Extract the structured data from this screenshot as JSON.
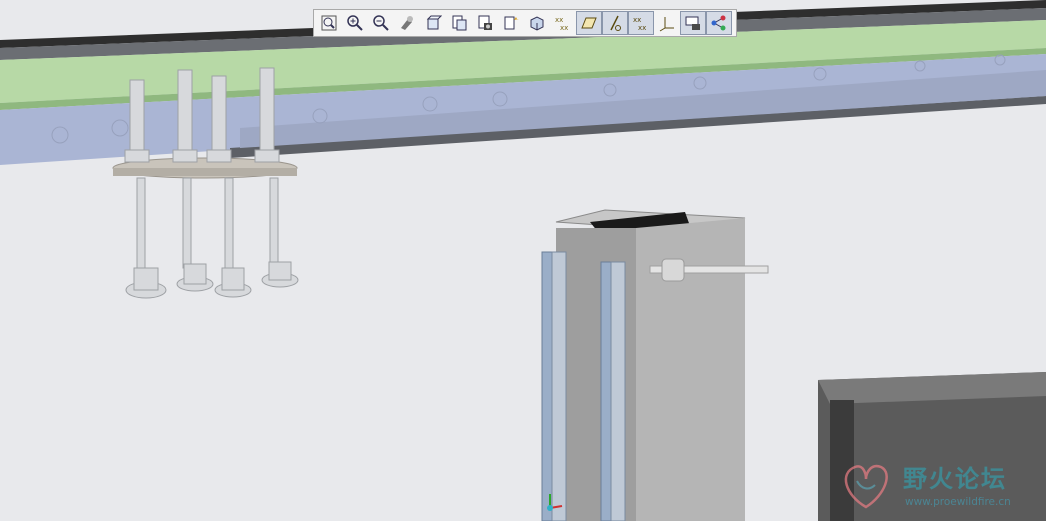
{
  "app": {
    "view_toolbar": {
      "buttons": [
        {
          "icon": "refit-icon",
          "toggled": false
        },
        {
          "icon": "zoom-in-icon",
          "toggled": false
        },
        {
          "icon": "zoom-out-icon",
          "toggled": false
        },
        {
          "icon": "repaint-icon",
          "toggled": false
        },
        {
          "icon": "display-style-icon",
          "toggled": false
        },
        {
          "icon": "saved-orientations-icon",
          "toggled": false
        },
        {
          "icon": "view-manager-icon",
          "toggled": false
        },
        {
          "icon": "spin-center-icon",
          "toggled": false
        },
        {
          "icon": "perspective-view-icon",
          "toggled": false
        },
        {
          "icon": "annotation-display-icon",
          "toggled": false
        },
        {
          "icon": "plane-display-icon",
          "toggled": true
        },
        {
          "icon": "axis-display-icon",
          "toggled": true
        },
        {
          "icon": "point-display-icon",
          "toggled": true
        },
        {
          "icon": "csys-display-icon",
          "toggled": false
        },
        {
          "icon": "appearance-editor-icon",
          "toggled": true
        },
        {
          "icon": "model-tree-icon",
          "toggled": true
        }
      ]
    }
  },
  "colors": {
    "background": "#e8e9ec",
    "conveyor_green": "#b7d9a6",
    "conveyor_blue": "#aab5d4",
    "column_gray": "#b5b5b5",
    "rail_blue": "#9aaec8",
    "accent_teal": "#3d8f9a"
  },
  "watermark": {
    "brand": "野火论坛",
    "url": "www.proewildfire.cn"
  }
}
